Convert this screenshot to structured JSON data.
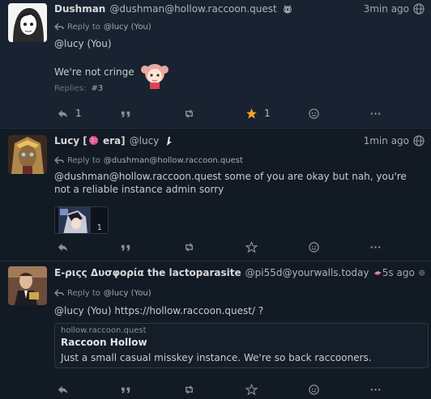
{
  "posts": [
    {
      "name": "Dushman",
      "acct": "@dushman@hollow.raccoon.quest",
      "time": "3min ago",
      "reply_label": "Reply to",
      "reply_target": "@lucy (You)",
      "mention_line": "@lucy (You)",
      "body": "We're not cringe",
      "replies_label": "Replies:",
      "replies_count": "#3",
      "actions": {
        "reply_count": "1",
        "favorite_count": "1"
      }
    },
    {
      "name": "Lucy [",
      "name_suffix": " era]",
      "acct": "@lucy",
      "time": "1min ago",
      "reply_label": "Reply to",
      "reply_target": "@dushman@hollow.raccoon.quest",
      "body": "@dushman@hollow.raccoon.quest some of you are okay but nah, you're not a reliable instance admin sorry",
      "attachment_count": "1"
    },
    {
      "name": "Ε-ριςς Δυσφορία the lactoparasite",
      "acct": "@pi55d@yourwalls.today",
      "time": "5s ago",
      "reply_label": "Reply to",
      "reply_target": "@lucy (You)",
      "body": "@lucy (You) https://hollow.raccoon.quest/ ?",
      "card": {
        "host": "hollow.raccoon.quest",
        "title": "Raccoon Hollow",
        "description": "Just a small casual misskey instance. We're so back raccooners."
      }
    }
  ],
  "icons": [
    "reply-icon",
    "quote-icon",
    "repeat-icon",
    "star-icon",
    "emoji-react-icon",
    "more-icon",
    "globe-icon"
  ],
  "colors": {
    "favorited": "#f5a623",
    "highlight_bg": "#182230",
    "bg": "#121a24"
  }
}
